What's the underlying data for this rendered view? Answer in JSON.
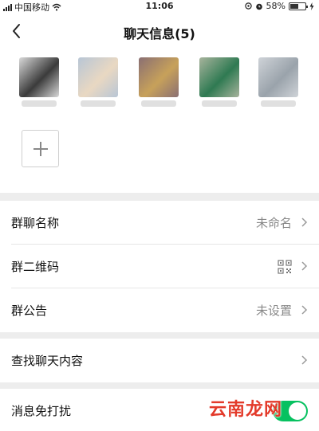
{
  "status_bar": {
    "carrier": "中国移动",
    "time": "11:06",
    "battery_percent": "58%",
    "battery_level": 0.58
  },
  "nav": {
    "title": "聊天信息(5)",
    "back_icon": "chevron-left-icon"
  },
  "members": {
    "avatars": [
      {
        "colors": [
          "#d9d9d9",
          "#3b3b3b"
        ]
      },
      {
        "colors": [
          "#b8c6d6",
          "#e9d8c2"
        ]
      },
      {
        "colors": [
          "#8a6f73",
          "#c7a15a"
        ]
      },
      {
        "colors": [
          "#a7b39c",
          "#2f7a52"
        ]
      },
      {
        "colors": [
          "#cfd3d8",
          "#9aa3ab"
        ]
      }
    ],
    "add_icon": "plus-icon"
  },
  "settings": {
    "group_name": {
      "label": "群聊名称",
      "value": "未命名"
    },
    "group_qr": {
      "label": "群二维码",
      "icon": "qr-code-icon"
    },
    "group_notice": {
      "label": "群公告",
      "value": "未设置"
    },
    "search_history": {
      "label": "查找聊天内容"
    },
    "mute": {
      "label": "消息免打扰",
      "enabled": true
    }
  },
  "watermark": {
    "text": "云南龙网"
  },
  "colors": {
    "accent": "#07c160",
    "background": "#ededed",
    "secondary_text": "#888888"
  }
}
